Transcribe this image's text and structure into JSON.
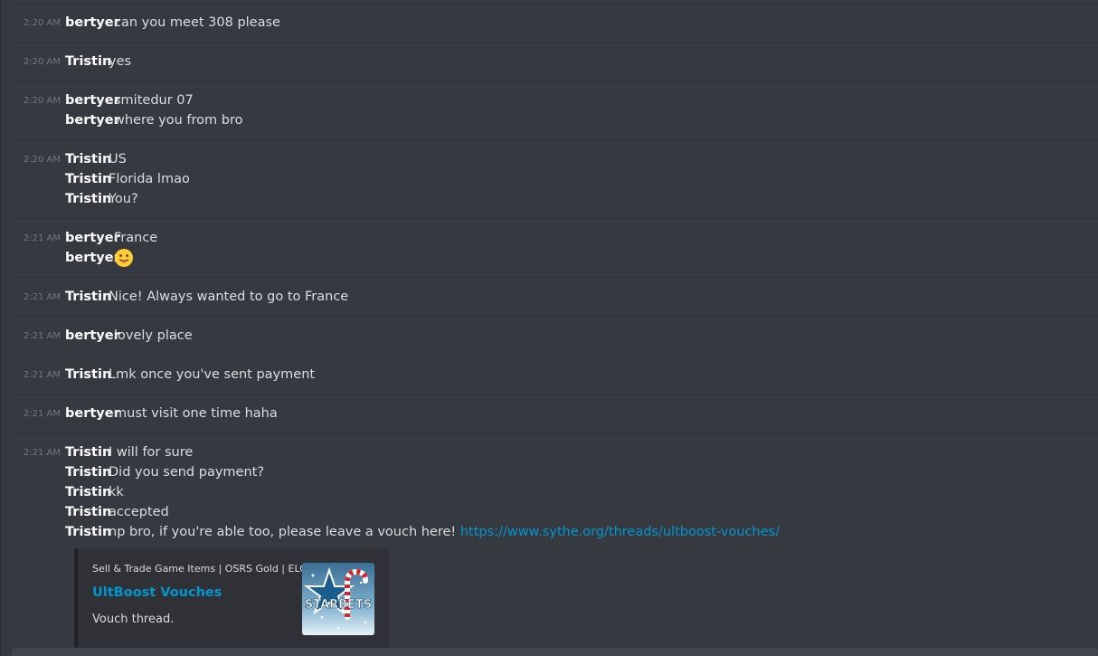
{
  "messages": [
    {
      "time": "2:20 AM",
      "lines": [
        {
          "author": "bertyer",
          "text": "can you meet 308 please"
        }
      ]
    },
    {
      "time": "2:20 AM",
      "lines": [
        {
          "author": "Tristin",
          "text": "yes"
        }
      ]
    },
    {
      "time": "2:20 AM",
      "lines": [
        {
          "author": "bertyer",
          "text": "smitedur 07"
        },
        {
          "author": "bertyer",
          "text": "where you from bro"
        }
      ]
    },
    {
      "time": "2:20 AM",
      "lines": [
        {
          "author": "Tristin",
          "text": "US"
        },
        {
          "author": "Tristin",
          "text": "Florida lmao"
        },
        {
          "author": "Tristin",
          "text": "You?"
        }
      ]
    },
    {
      "time": "2:21 AM",
      "lines": [
        {
          "author": "bertyer",
          "text": "France"
        },
        {
          "author": "bertyer",
          "text": "",
          "emoji": "stuck-out-tongue-emoji"
        }
      ]
    },
    {
      "time": "2:21 AM",
      "lines": [
        {
          "author": "Tristin",
          "text": "Nice! Always wanted to go to France"
        }
      ]
    },
    {
      "time": "2:21 AM",
      "lines": [
        {
          "author": "bertyer",
          "text": "lovely place"
        }
      ]
    },
    {
      "time": "2:21 AM",
      "lines": [
        {
          "author": "Tristin",
          "text": "Lmk once you've sent payment"
        }
      ]
    },
    {
      "time": "2:21 AM",
      "lines": [
        {
          "author": "bertyer",
          "text": "must visit one time haha"
        }
      ]
    },
    {
      "time": "2:21 AM",
      "lines": [
        {
          "author": "Tristin",
          "text": "I will for sure"
        },
        {
          "author": "Tristin",
          "text": "Did you send payment?"
        },
        {
          "author": "Tristin",
          "text": "kk"
        },
        {
          "author": "Tristin",
          "text": "accepted"
        },
        {
          "author": "Tristin",
          "text": "np bro, if you're able too, please leave a vouch here!",
          "link": "https://www.sythe.org/threads/ultboost-vouches/"
        }
      ]
    }
  ],
  "embed": {
    "provider": "Sell & Trade Game Items | OSRS Gold | ELO",
    "title": "UltBoost Vouches",
    "description": "Vouch thread.",
    "thumbnail_text": "STARBETS",
    "thumbnail_icon": "starbets-logo"
  },
  "colors": {
    "background": "#36393f",
    "author": "#ffffff",
    "text": "#dcddde",
    "link": "#0096cf",
    "timestamp": "#72767d"
  }
}
